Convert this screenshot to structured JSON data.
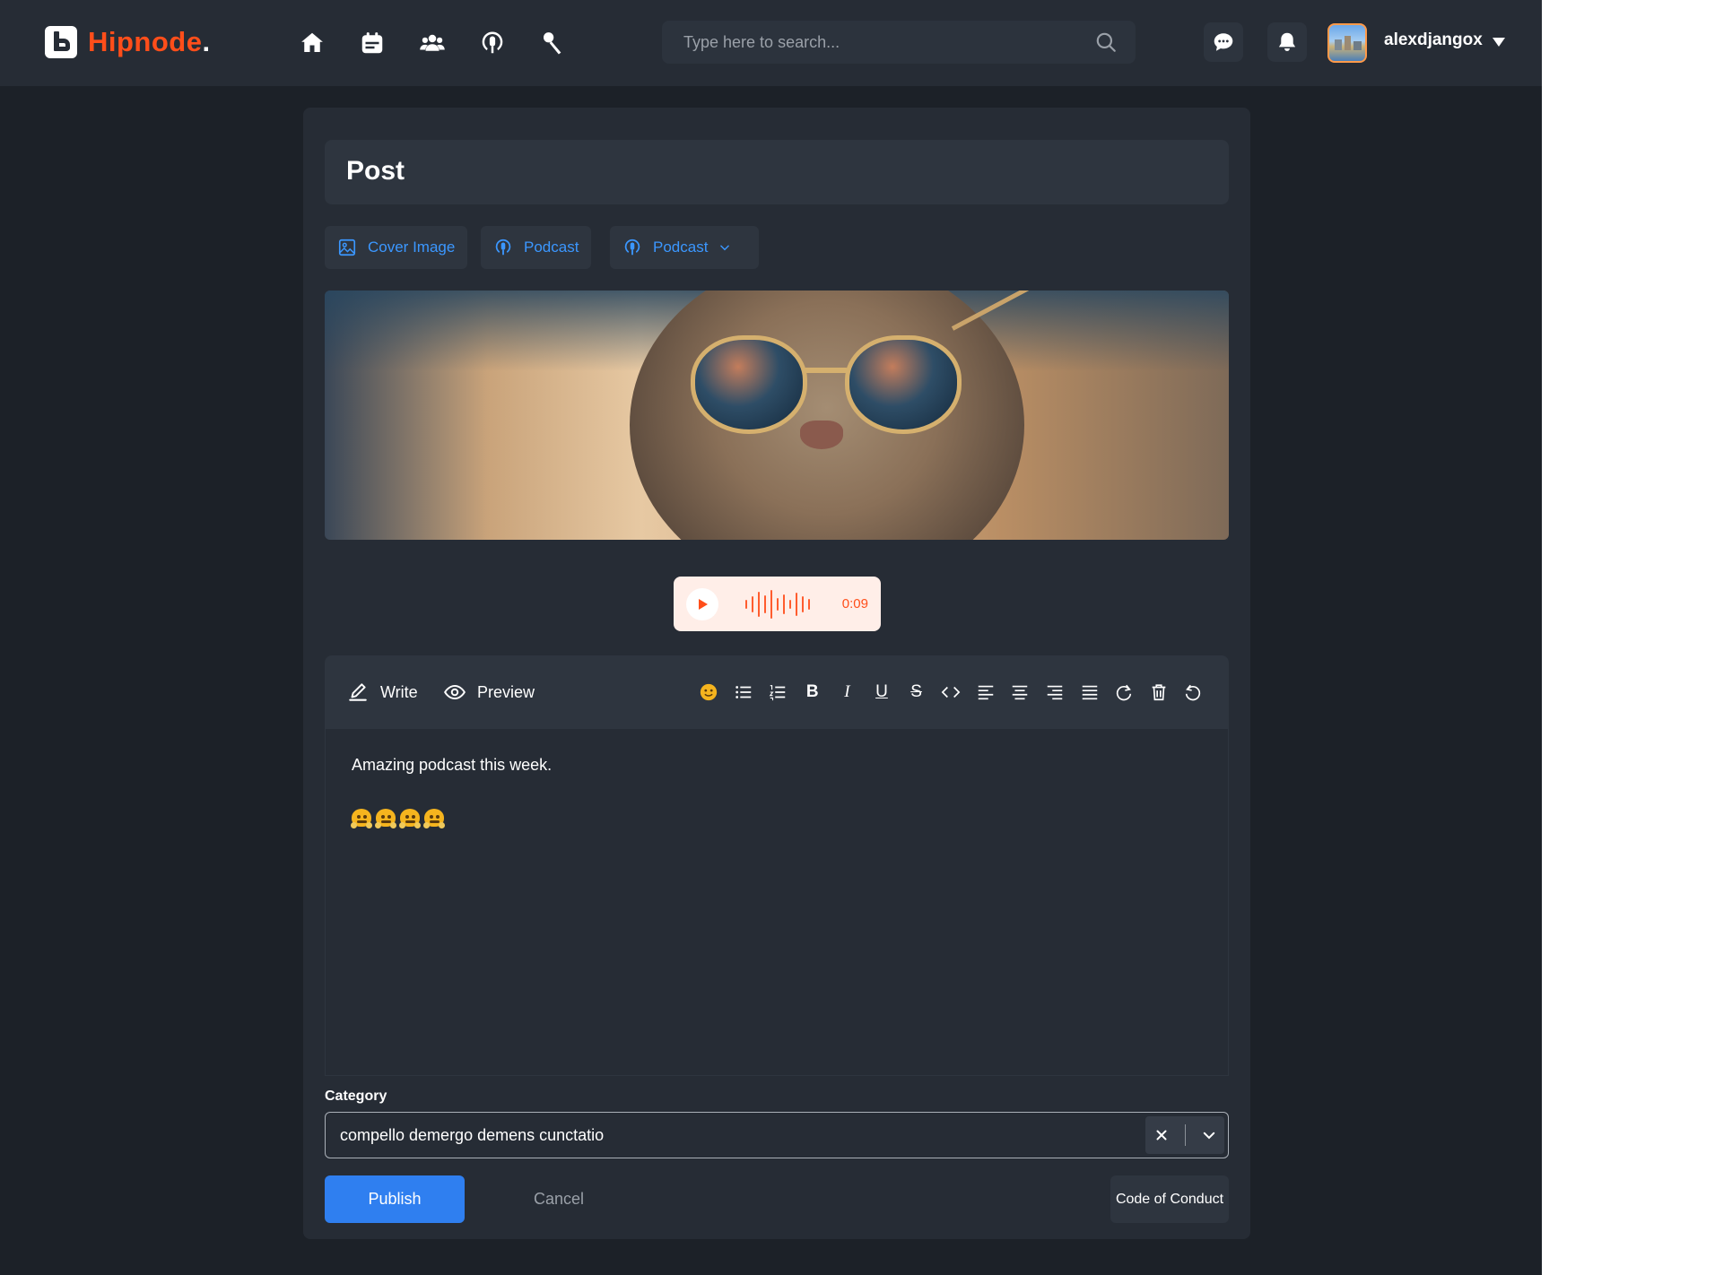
{
  "brand": {
    "name": "Hipnode",
    "dot": ".",
    "accent": "#ff4e1a"
  },
  "nav": {
    "items": [
      {
        "name": "home",
        "icon": "home-icon"
      },
      {
        "name": "calendar",
        "icon": "calendar-icon"
      },
      {
        "name": "groups",
        "icon": "groups-icon"
      },
      {
        "name": "podcasts",
        "icon": "podcast-icon"
      },
      {
        "name": "interviews",
        "icon": "microphone-icon"
      }
    ]
  },
  "search": {
    "placeholder": "Type here to search...",
    "value": ""
  },
  "header": {
    "username": "alexdjangox",
    "message_icon": "chat-bubble-icon",
    "notification_icon": "bell-icon"
  },
  "post": {
    "title": "Post",
    "chips": {
      "cover_image": "Cover Image",
      "podcast": "Podcast",
      "podcast_select": "Podcast"
    },
    "audio": {
      "duration": "0:09",
      "color": "#ff5c2e"
    },
    "editor": {
      "write_tab": "Write",
      "preview_tab": "Preview",
      "content": "Amazing podcast this week.",
      "emoji_count": 4,
      "toolbar": [
        "emoji-icon",
        "bullet-list-icon",
        "numbered-list-icon",
        "bold-icon",
        "italic-icon",
        "underline-icon",
        "strikethrough-icon",
        "code-icon",
        "align-left-icon",
        "align-center-icon",
        "align-right-icon",
        "align-justify-icon",
        "redo-icon",
        "trash-icon",
        "undo-icon"
      ],
      "bold_glyph": "B",
      "italic_glyph": "I",
      "underline_glyph": "U",
      "strike_glyph": "S"
    },
    "category": {
      "label": "Category",
      "value": "compello demergo demens cunctatio"
    },
    "actions": {
      "publish": "Publish",
      "cancel": "Cancel",
      "code_of_conduct": "Code of Conduct"
    }
  },
  "colors": {
    "background": "#1c2128",
    "surface": "#262c35",
    "surface_alt": "#2e353f",
    "primary": "#2f7ff0",
    "link": "#3b97ff"
  }
}
